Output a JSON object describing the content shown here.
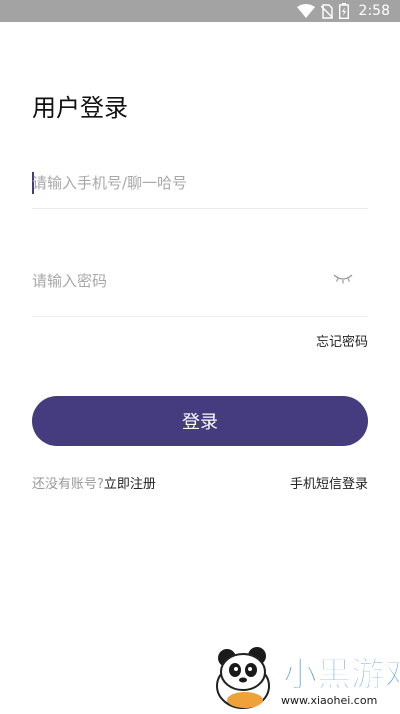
{
  "status_bar": {
    "time": "2:58"
  },
  "page": {
    "title": "用户登录"
  },
  "form": {
    "phone_placeholder": "请输入手机号/聊一哈号",
    "password_placeholder": "请输入密码",
    "forgot_password": "忘记密码",
    "login_button": "登录",
    "no_account": "还没有账号?",
    "register": "立即注册",
    "sms_login": "手机短信登录"
  },
  "watermark": {
    "brand": "小黑游戏",
    "url": "www.xiaohei.com"
  },
  "colors": {
    "accent": "#443c7e",
    "status_bar": "#a3a3a3",
    "placeholder": "#a8a8a8"
  },
  "icons": [
    "wifi-icon",
    "no-sim-icon",
    "battery-icon",
    "eye-closed-icon",
    "panda-logo-icon"
  ]
}
